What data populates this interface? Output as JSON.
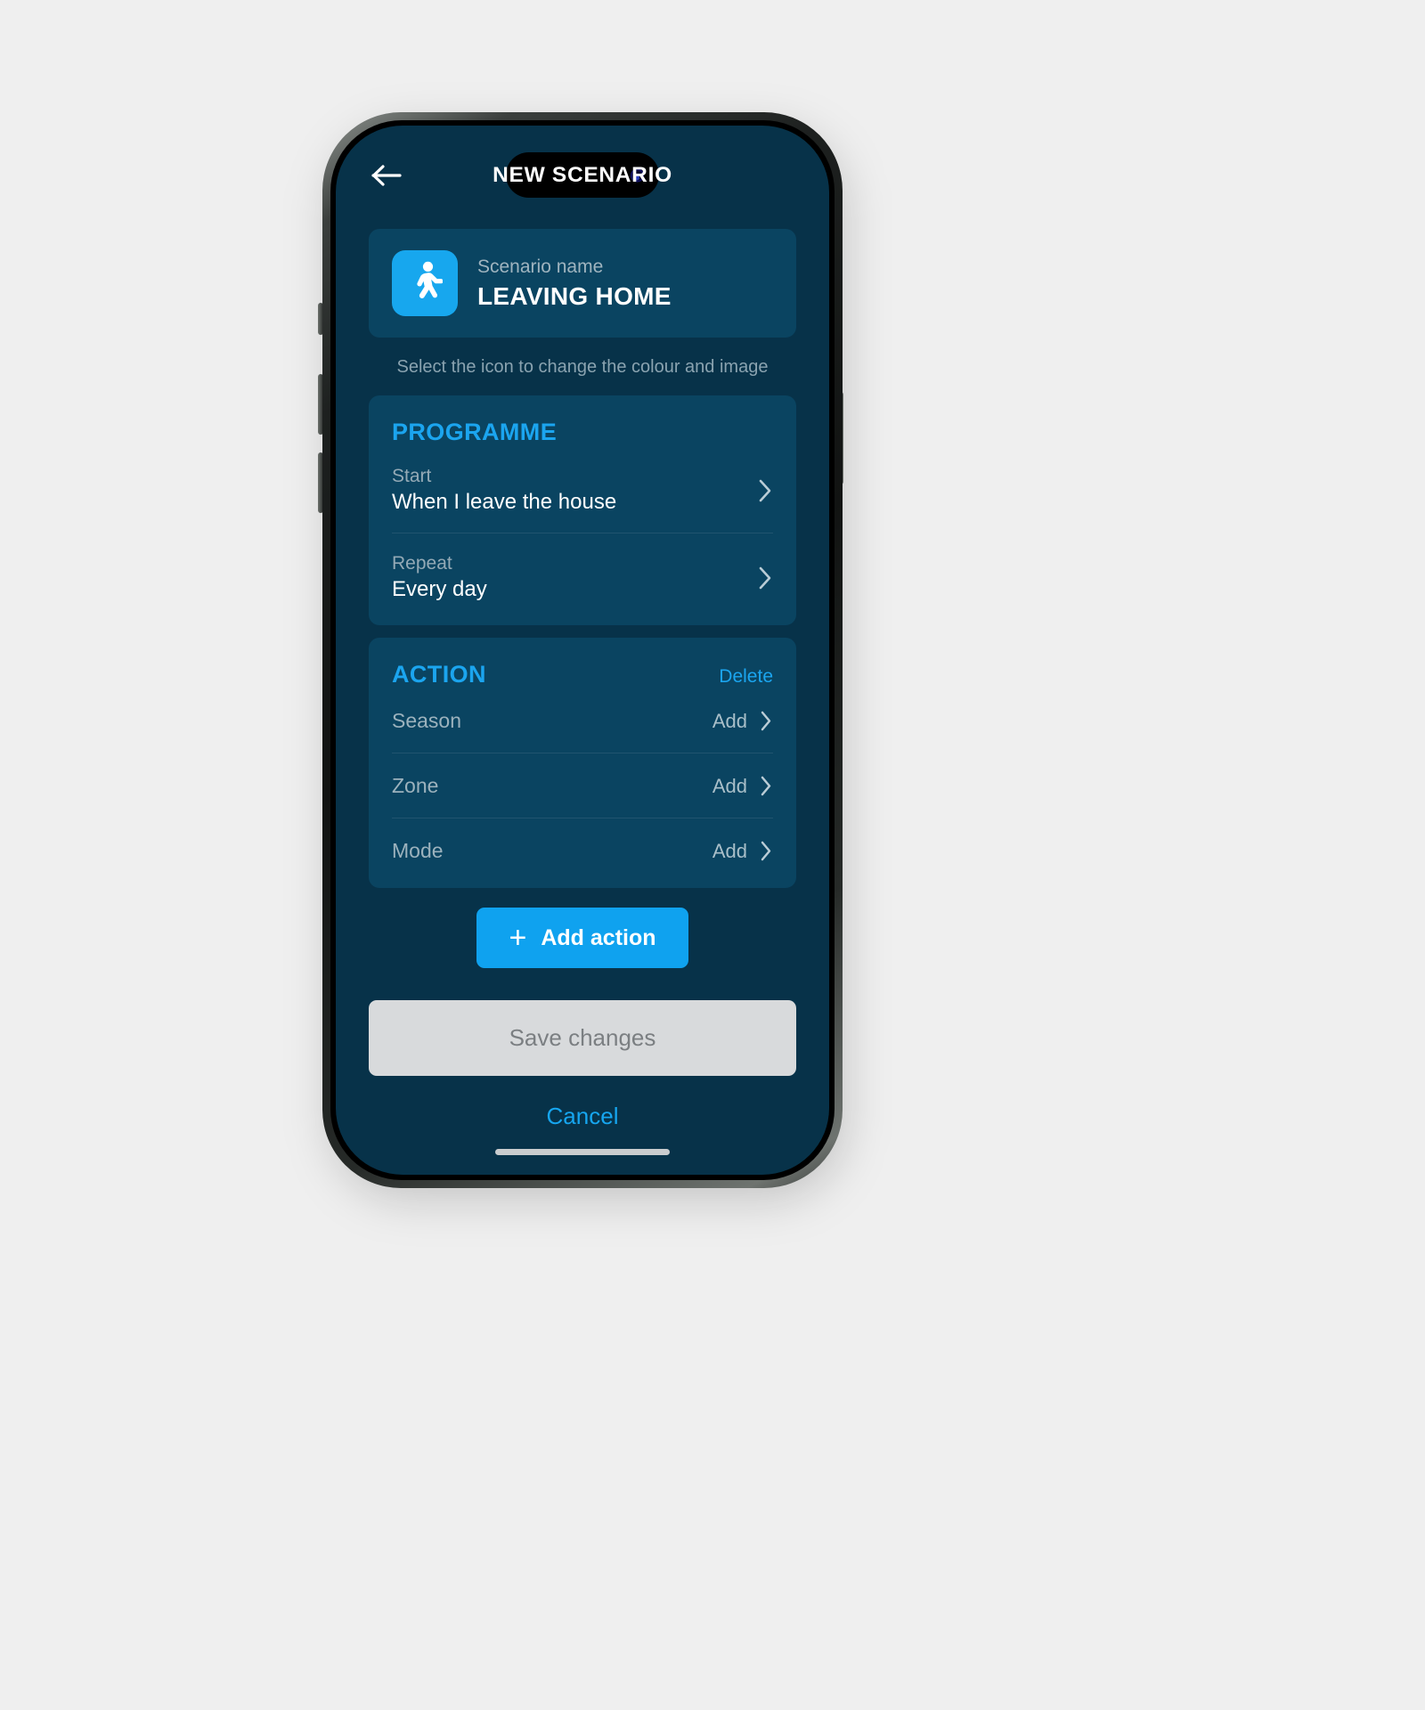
{
  "theme": {
    "screen_bg": "#073249",
    "card_bg": "#0a4461",
    "accent_blue": "#1ba5ef",
    "icon_tile_blue": "#17a7ee",
    "button_blue": "#0fa2ef",
    "muted_text": "#9fb4bf",
    "save_bg": "#d8dadc",
    "save_text": "#7b7f82"
  },
  "navbar": {
    "title": "NEW SCENARIO",
    "back_icon": "arrow-left-icon"
  },
  "scenario": {
    "icon": "walking-person-icon",
    "name_label": "Scenario name",
    "name_value": "LEAVING HOME",
    "hint": "Select the icon to change the colour and image"
  },
  "programme": {
    "title": "PROGRAMME",
    "rows": [
      {
        "label": "Start",
        "value": "When I leave the house",
        "chevron": "chevron-right-icon"
      },
      {
        "label": "Repeat",
        "value": "Every day",
        "chevron": "chevron-right-icon"
      }
    ]
  },
  "action": {
    "title": "ACTION",
    "delete_label": "Delete",
    "rows": [
      {
        "label": "Season",
        "add_label": "Add",
        "chevron": "chevron-right-icon"
      },
      {
        "label": "Zone",
        "add_label": "Add",
        "chevron": "chevron-right-icon"
      },
      {
        "label": "Mode",
        "add_label": "Add",
        "chevron": "chevron-right-icon"
      }
    ]
  },
  "footer": {
    "add_action_label": "Add action",
    "add_action_icon": "plus-icon",
    "save_label": "Save changes",
    "cancel_label": "Cancel"
  }
}
